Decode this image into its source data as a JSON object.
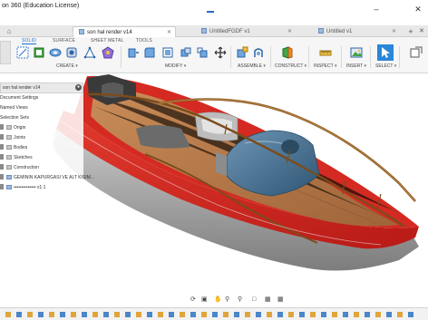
{
  "window": {
    "title": "on 360 (Education License)",
    "minimize_glyph": "–",
    "close_glyph": "✕"
  },
  "tabs": [
    {
      "label": "son hal render v14",
      "active": true
    },
    {
      "label": "UntitledFGDF v1",
      "active": false
    },
    {
      "label": "Untitled v1",
      "active": false
    }
  ],
  "toolbar": {
    "workspace_tabs": [
      "SOLID",
      "SURFACE",
      "SHEET METAL",
      "TOOLS"
    ],
    "active_workspace": "SOLID",
    "groups": [
      "CREATE",
      "MODIFY",
      "ASSEMBLE",
      "CONSTRUCT",
      "INSPECT",
      "INSERT",
      "SELECT"
    ]
  },
  "browser": {
    "title": "son hal render v14",
    "items": [
      {
        "label": "Document Settings"
      },
      {
        "label": "Named Views"
      },
      {
        "label": "Selection Sets"
      },
      {
        "label": "Origin"
      },
      {
        "label": "Joints"
      },
      {
        "label": "Bodies"
      },
      {
        "label": "Sketches"
      },
      {
        "label": "Construction"
      },
      {
        "label": "GEMININ KAPURGASI VE ALT KISIM..."
      },
      {
        "label": "•••••••••••••• v1:1"
      }
    ]
  },
  "colors": {
    "accent": "#1d6fd0",
    "hull_red": "#d9231f",
    "deck_wood": "#b7794a",
    "hull_grey": "#9e9e9e",
    "glass": "#3f6a88",
    "rail": "#8a5a22"
  },
  "icons": [
    "home-icon",
    "sketch-icon",
    "extrude-icon",
    "revolve-icon",
    "sweep-icon",
    "press-pull-icon",
    "fillet-icon",
    "move-icon",
    "joint-icon",
    "plane-icon",
    "measure-icon",
    "insert-image-icon",
    "select-arrow-icon",
    "orbit-icon",
    "pan-icon",
    "zoom-icon",
    "display-settings-icon",
    "grid-icon"
  ]
}
